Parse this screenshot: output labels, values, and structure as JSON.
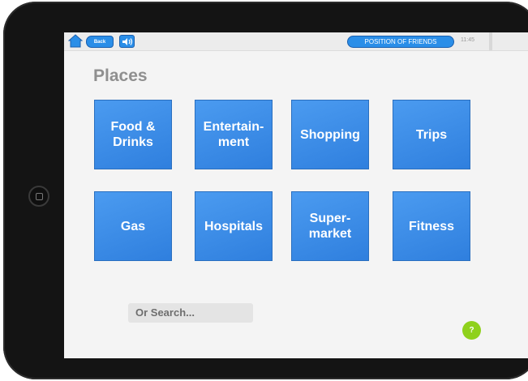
{
  "topbar": {
    "back_label": "Back",
    "position_label": "POSITION OF FRIENDS",
    "time": "11:45"
  },
  "page": {
    "title": "Places"
  },
  "tiles": [
    {
      "label": "Food &\nDrinks"
    },
    {
      "label": "Entertain-\nment"
    },
    {
      "label": "Shopping"
    },
    {
      "label": "Trips"
    },
    {
      "label": "Gas"
    },
    {
      "label": "Hospitals"
    },
    {
      "label": "Super-\nmarket"
    },
    {
      "label": "Fitness"
    }
  ],
  "search": {
    "placeholder": "Or Search..."
  },
  "help": {
    "label": "?"
  },
  "icons": {
    "home": "home-icon",
    "sound": "speaker-icon",
    "device_home": "device-home-button"
  },
  "colors": {
    "tile_blue": "#3a8be8",
    "button_blue": "#2a8ee8",
    "help_green": "#8fd11c",
    "title_gray": "#8f8f8f"
  }
}
